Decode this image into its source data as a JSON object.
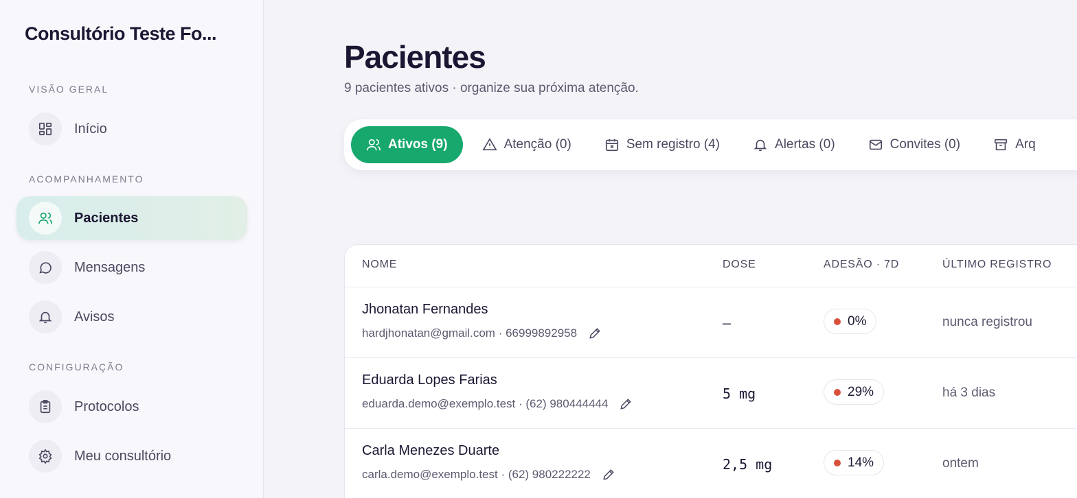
{
  "sidebar": {
    "brand": "Consultório Teste Fo...",
    "sections": {
      "overview": "VISÃO GERAL",
      "tracking": "ACOMPANHAMENTO",
      "config": "CONFIGURAÇÃO"
    },
    "items": [
      {
        "label": "Início",
        "icon": "dashboard-icon"
      },
      {
        "label": "Pacientes",
        "icon": "users-icon",
        "active": true
      },
      {
        "label": "Mensagens",
        "icon": "message-icon"
      },
      {
        "label": "Avisos",
        "icon": "bell-icon"
      },
      {
        "label": "Protocolos",
        "icon": "clipboard-icon"
      },
      {
        "label": "Meu consultório",
        "icon": "gear-icon"
      }
    ]
  },
  "main": {
    "title": "Pacientes",
    "subtitle": "9 pacientes ativos · organize sua próxima atenção.",
    "tabs": [
      {
        "label": "Ativos (9)",
        "icon": "users-icon",
        "active": true
      },
      {
        "label": "Atenção (0)",
        "icon": "warning-icon"
      },
      {
        "label": "Sem registro (4)",
        "icon": "calendar-x-icon"
      },
      {
        "label": "Alertas (0)",
        "icon": "bell-icon"
      },
      {
        "label": "Convites (0)",
        "icon": "mail-icon"
      },
      {
        "label": "Arq",
        "icon": "archive-icon"
      }
    ],
    "table": {
      "headers": [
        "NOME",
        "DOSE",
        "ADESÃO · 7D",
        "ÚLTIMO REGISTRO"
      ],
      "rows": [
        {
          "name": "Jhonatan Fernandes",
          "contact": "hardjhonatan@gmail.com · 66999892958",
          "dose": "–",
          "adherence": "0%",
          "last": "nunca registrou"
        },
        {
          "name": "Eduarda Lopes Farias",
          "contact": "eduarda.demo@exemplo.test · (62) 980444444",
          "dose": "5 mg",
          "adherence": "29%",
          "last": "há 3 dias"
        },
        {
          "name": "Carla Menezes Duarte",
          "contact": "carla.demo@exemplo.test · (62) 980222222",
          "dose": "2,5 mg",
          "adherence": "14%",
          "last": "ontem"
        }
      ]
    }
  },
  "colors": {
    "accent": "#17a86d",
    "adherence_dot": "#d9503a",
    "text_primary": "#1b1733"
  }
}
